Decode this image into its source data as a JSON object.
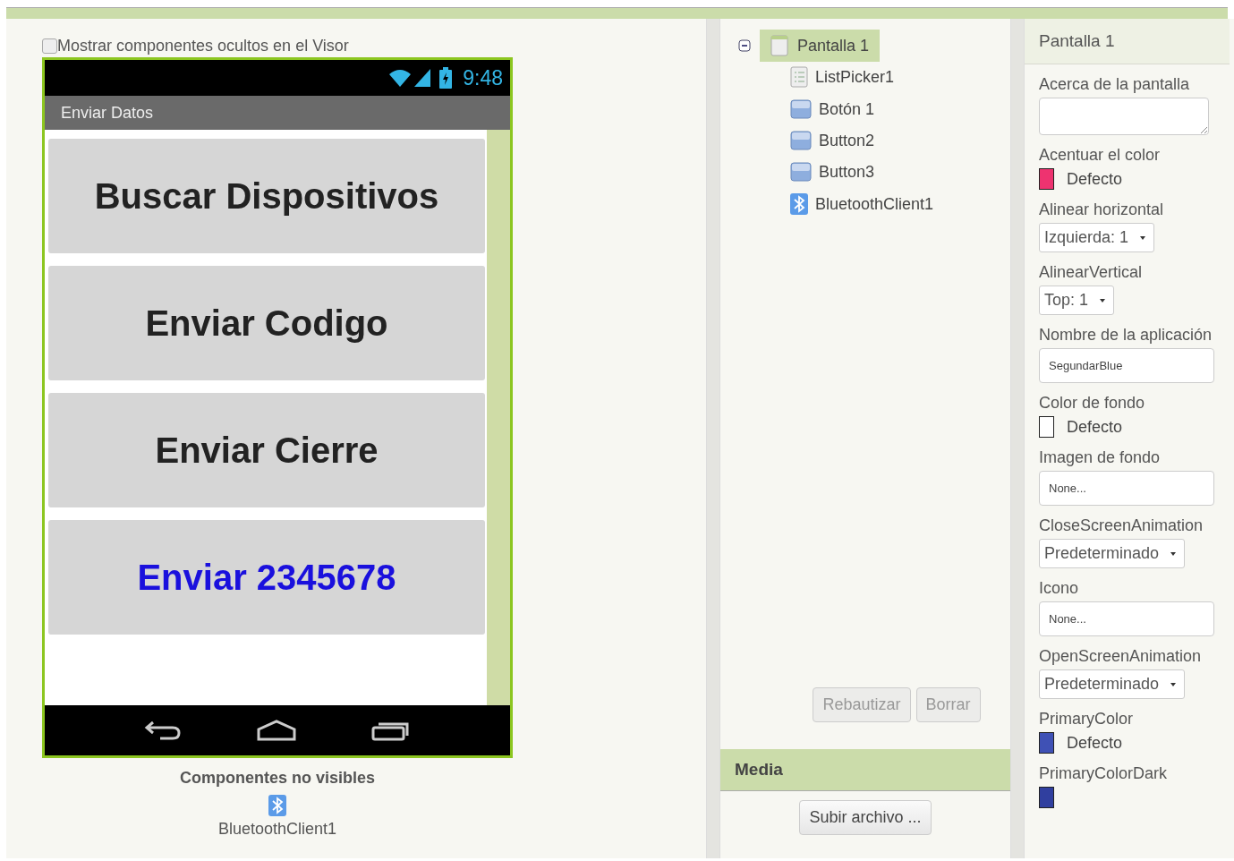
{
  "viewer": {
    "show_hidden": {
      "label": "Mostrar componentes ocultos en el Visor",
      "checked": false
    },
    "phone": {
      "time": "9:48",
      "title": "Enviar Datos",
      "buttons": [
        {
          "text": "Buscar Dispositivos",
          "color": "#222222"
        },
        {
          "text": "Enviar Codigo",
          "color": "#222222"
        },
        {
          "text": "Enviar Cierre",
          "color": "#222222"
        },
        {
          "text": "Enviar 2345678",
          "color": "#1a10dd"
        }
      ]
    },
    "nonvisible": {
      "title": "Componentes no visibles",
      "items": [
        {
          "label": "BluetoothClient1",
          "kind": "bluetooth"
        }
      ]
    }
  },
  "components": {
    "tree": [
      {
        "label": "Pantalla 1",
        "kind": "screen",
        "selected": true,
        "expanded": true,
        "children": [
          {
            "label": "ListPicker1",
            "kind": "listpicker",
            "selected": false
          },
          {
            "label": "Botón 1",
            "kind": "button",
            "selected": false
          },
          {
            "label": "Button2",
            "kind": "button",
            "selected": false
          },
          {
            "label": "Button3",
            "kind": "button",
            "selected": false
          },
          {
            "label": "BluetoothClient1",
            "kind": "bluetooth",
            "selected": false
          }
        ]
      }
    ],
    "buttons": [
      {
        "label": "Rebautizar",
        "disabled": true
      },
      {
        "label": "Borrar",
        "disabled": true
      }
    ]
  },
  "media": {
    "title": "Media",
    "upload_button": "Subir archivo ..."
  },
  "properties": {
    "title": "Pantalla 1",
    "items": [
      {
        "label": "Acerca de la pantalla",
        "kind": "textarea"
      },
      {
        "label": "Acentuar el color",
        "kind": "color",
        "color": "#ee3370",
        "value": "Defecto"
      },
      {
        "label": "Alinear horizontal",
        "kind": "dropdown",
        "value": "Izquierda: 1"
      },
      {
        "label": "AlinearVertical",
        "kind": "dropdown",
        "value": "Top: 1"
      },
      {
        "label": "Nombre de la aplicación",
        "kind": "text",
        "value": "SegundarBlue"
      },
      {
        "label": "Color de fondo",
        "kind": "color",
        "color": "#ffffff",
        "value": "Defecto"
      },
      {
        "label": "Imagen de fondo",
        "kind": "text",
        "value": "None..."
      },
      {
        "label": "CloseScreenAnimation",
        "kind": "dropdown",
        "value": "Predeterminado"
      },
      {
        "label": "Icono",
        "kind": "text",
        "value": "None..."
      },
      {
        "label": "OpenScreenAnimation",
        "kind": "dropdown",
        "value": "Predeterminado"
      },
      {
        "label": "PrimaryColor",
        "kind": "color",
        "color": "#3f51b5",
        "value": "Defecto"
      },
      {
        "label": "PrimaryColorDark",
        "kind": "color",
        "color": "#303f9f"
      }
    ]
  }
}
